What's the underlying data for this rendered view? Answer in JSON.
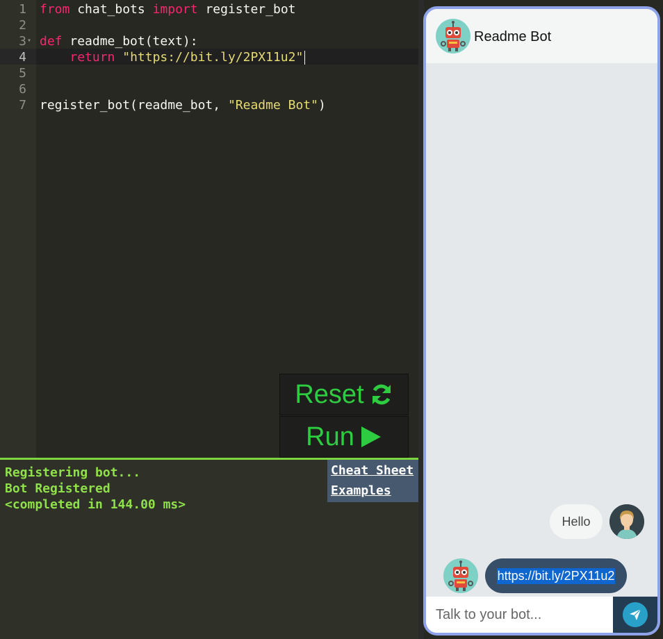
{
  "editor": {
    "line_numbers": [
      "1",
      "2",
      "3",
      "4",
      "5",
      "6",
      "7"
    ],
    "lines": [
      [
        {
          "t": "kw",
          "v": "from"
        },
        {
          "t": "",
          "v": " chat_bots "
        },
        {
          "t": "kw",
          "v": "import"
        },
        {
          "t": "",
          "v": " register_bot"
        }
      ],
      [],
      [
        {
          "t": "kw",
          "v": "def"
        },
        {
          "t": "",
          "v": " readme_bot(text):"
        }
      ],
      [
        {
          "t": "",
          "v": "    "
        },
        {
          "t": "kw",
          "v": "return"
        },
        {
          "t": "",
          "v": " "
        },
        {
          "t": "str",
          "v": "\"https://bit.ly/2PX11u2\""
        }
      ],
      [],
      [],
      [
        {
          "t": "",
          "v": "register_bot(readme_bot, "
        },
        {
          "t": "str",
          "v": "\"Readme Bot\""
        },
        {
          "t": "",
          "v": ")"
        }
      ]
    ]
  },
  "buttons": {
    "reset_label": "Reset",
    "run_label": "Run"
  },
  "console": {
    "lines": [
      "Registering bot...",
      "Bot Registered",
      "<completed in 144.00 ms>"
    ]
  },
  "links": {
    "cheat_sheet": "Cheat Sheet",
    "examples": "Examples"
  },
  "chat": {
    "title": "Readme Bot",
    "messages": [
      {
        "from": "user",
        "text": "Hello"
      },
      {
        "from": "bot",
        "text": "https://bit.ly/2PX11u2"
      }
    ],
    "input_placeholder": "Talk to your bot..."
  },
  "colors": {
    "editor_bg": "#272822",
    "keyword": "#f92672",
    "string": "#e6db74",
    "button_text": "#2ecc40",
    "console_text": "#8fe04a",
    "chat_border": "#8ea2e9"
  },
  "icons": [
    "refresh-icon",
    "play-icon",
    "robot-icon",
    "user-avatar-icon",
    "send-icon"
  ]
}
